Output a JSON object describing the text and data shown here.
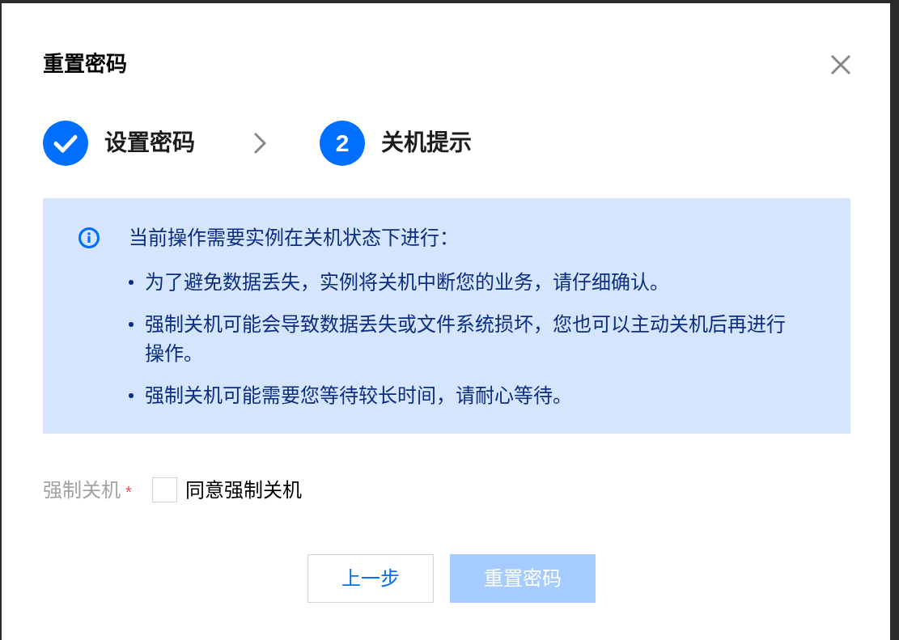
{
  "dialog": {
    "title": "重置密码",
    "steps": [
      {
        "kind": "done",
        "label": "设置密码"
      },
      {
        "kind": "current",
        "number": "2",
        "label": "关机提示"
      }
    ],
    "notice": {
      "heading": "当前操作需要实例在关机状态下进行：",
      "items": [
        "为了避免数据丢失，实例将关机中断您的业务，请仔细确认。",
        "强制关机可能会导致数据丢失或文件系统损坏，您也可以主动关机后再进行操作。",
        "强制关机可能需要您等待较长时间，请耐心等待。"
      ]
    },
    "force_shutdown": {
      "label": "强制关机",
      "required_mark": "*",
      "checkbox_label": "同意强制关机",
      "checked": false
    },
    "buttons": [
      {
        "kind": "secondary",
        "label": "上一步",
        "disabled": false
      },
      {
        "kind": "primary",
        "label": "重置密码",
        "disabled": true
      }
    ]
  }
}
